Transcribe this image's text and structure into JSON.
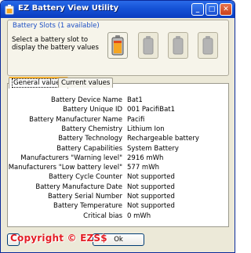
{
  "window": {
    "title": "EZ Battery View Utility"
  },
  "titlebar": {
    "minimize": "_",
    "maximize": "□",
    "close": "✕"
  },
  "slots": {
    "title": "Battery Slots (1 available)",
    "description": "Select a battery slot to display the battery values",
    "items": [
      {
        "state": "active",
        "icon": "battery-charged-icon"
      },
      {
        "state": "empty",
        "icon": "battery-empty-icon"
      },
      {
        "state": "empty",
        "icon": "battery-empty-icon"
      },
      {
        "state": "empty",
        "icon": "battery-empty-icon"
      }
    ]
  },
  "tabs": [
    {
      "label": "General values",
      "active": true
    },
    {
      "label": "Current values",
      "active": false
    }
  ],
  "properties": [
    {
      "label": "Battery Device Name",
      "value": "Bat1"
    },
    {
      "label": "Battery Unique ID",
      "value": "001 PacifiBat1"
    },
    {
      "label": "Battery Manufacturer Name",
      "value": "Pacifi"
    },
    {
      "label": "Battery Chemistry",
      "value": "Lithium Ion"
    },
    {
      "label": "Battery Technology",
      "value": "Rechargeable battery"
    },
    {
      "label": "Battery Capabilities",
      "value": "System Battery"
    },
    {
      "label": "Manufacturers \"Warning level\"",
      "value": "2916 mWh"
    },
    {
      "label": "Manufacturers \"Low battery level\"",
      "value": "577 mWh"
    },
    {
      "label": "Battery Cycle Counter",
      "value": "Not supported"
    },
    {
      "label": "Battery Manufacture Date",
      "value": "Not supported"
    },
    {
      "label": "Battery Serial Number",
      "value": "Not supported"
    },
    {
      "label": "Battery Temperature",
      "value": "Not supported"
    },
    {
      "label": "Critical bias",
      "value": "0 mWh"
    }
  ],
  "buttons": {
    "ok": "Ok"
  },
  "watermark": "Copyright © EZS$",
  "colors": {
    "titlebar": "#1552d6",
    "slots_title": "#1d4fc4",
    "battery_fill": "#f5a623",
    "watermark": "#e31e24"
  }
}
